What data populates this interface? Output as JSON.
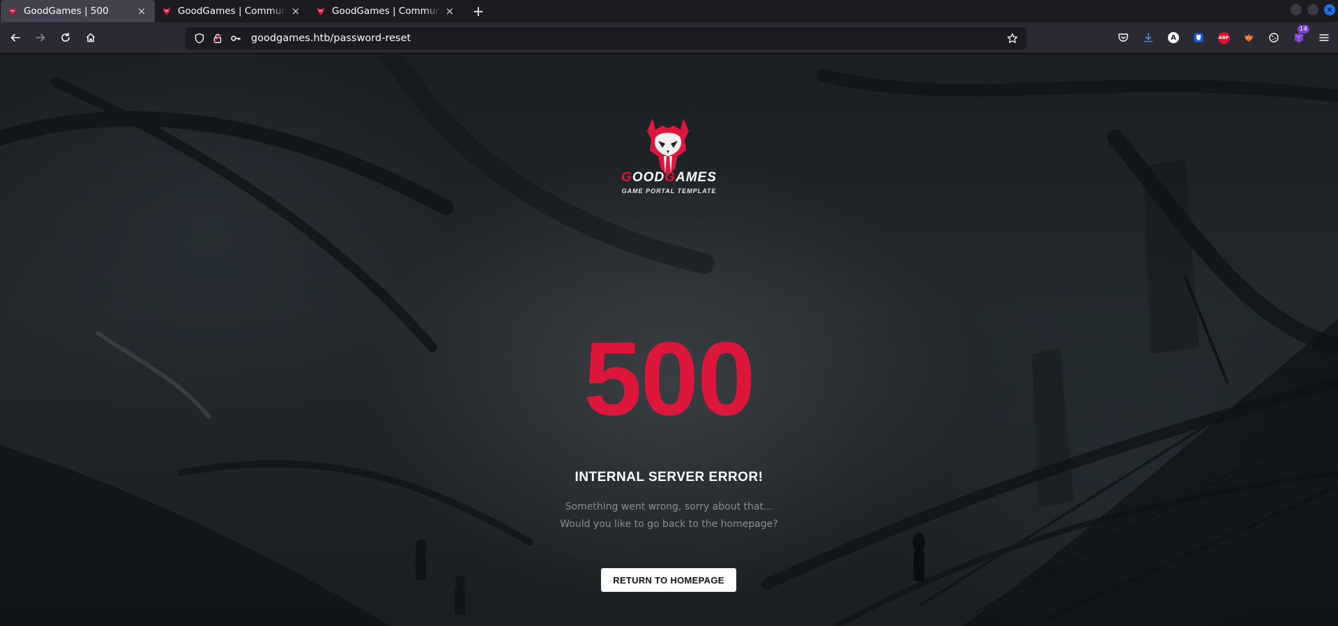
{
  "browser": {
    "tabs": [
      {
        "title": "GoodGames | 500",
        "active": true
      },
      {
        "title": "GoodGames | Community",
        "active": false
      },
      {
        "title": "GoodGames | Community",
        "active": false
      }
    ],
    "close_glyph": "×",
    "new_tab_glyph": "+",
    "url": "goodgames.htb/password-reset",
    "toolbar_badge": "14",
    "toolbar_abp": "ABP",
    "toolbar_a": "A",
    "window_close_glyph": "✕"
  },
  "page": {
    "brand_part1_red": "G",
    "brand_part1": "OOD",
    "brand_part2_red": "G",
    "brand_part2": "AMES",
    "tagline": "GAME PORTAL TEMPLATE",
    "error_code": "500",
    "error_title": "INTERNAL SERVER ERROR!",
    "message_line1": "Something went wrong, sorry about that...",
    "message_line2": "Would you like to go back to the homepage?",
    "button_label": "RETURN TO HOMEPAGE"
  },
  "colors": {
    "accent": "#dd163b",
    "tab_active": "#42414d",
    "toolbar": "#2b2a33",
    "chrome": "#1c1b22"
  },
  "icons": [
    "goodgames-favicon",
    "back-arrow-icon",
    "forward-arrow-icon",
    "reload-icon",
    "home-icon",
    "shield-icon",
    "lock-icon",
    "key-icon",
    "star-icon",
    "pocket-icon",
    "download-icon",
    "account-icon",
    "bitwarden-icon",
    "adblock-icon",
    "foxyproxy-icon",
    "cookie-icon",
    "extension-icon",
    "menu-icon",
    "goodgames-logo"
  ]
}
